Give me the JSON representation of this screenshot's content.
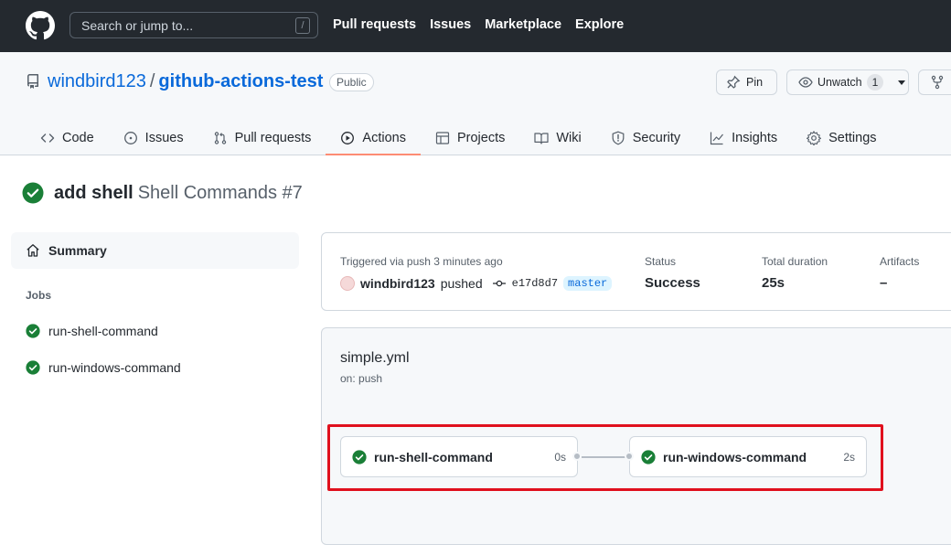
{
  "header": {
    "search_placeholder": "Search or jump to...",
    "search_shortcut": "/",
    "nav": [
      "Pull requests",
      "Issues",
      "Marketplace",
      "Explore"
    ]
  },
  "repo": {
    "owner": "windbird123",
    "separator": "/",
    "name": "github-actions-test",
    "visibility": "Public",
    "pin_label": "Pin",
    "watch_label": "Unwatch",
    "watch_count": "1"
  },
  "tabs": [
    {
      "label": "Code",
      "icon": "code-icon"
    },
    {
      "label": "Issues",
      "icon": "issue-icon"
    },
    {
      "label": "Pull requests",
      "icon": "pull-request-icon"
    },
    {
      "label": "Actions",
      "icon": "play-icon",
      "active": true
    },
    {
      "label": "Projects",
      "icon": "table-icon"
    },
    {
      "label": "Wiki",
      "icon": "book-icon"
    },
    {
      "label": "Security",
      "icon": "shield-icon"
    },
    {
      "label": "Insights",
      "icon": "graph-icon"
    },
    {
      "label": "Settings",
      "icon": "gear-icon"
    }
  ],
  "run": {
    "commit_message": "add shell",
    "workflow_and_number": "Shell Commands #7"
  },
  "sidebar": {
    "summary_label": "Summary",
    "jobs_label": "Jobs",
    "jobs": [
      "run-shell-command",
      "run-windows-command"
    ]
  },
  "summary_card": {
    "trigger": "Triggered via push 3 minutes ago",
    "actor": "windbird123",
    "action": "pushed",
    "sha": "e17d8d7",
    "branch": "master",
    "status_label": "Status",
    "status_value": "Success",
    "duration_label": "Total duration",
    "duration_value": "25s",
    "artifacts_label": "Artifacts",
    "artifacts_value": "–"
  },
  "workflow": {
    "file": "simple.yml",
    "on": "on: push",
    "jobs": [
      {
        "name": "run-shell-command",
        "duration": "0s"
      },
      {
        "name": "run-windows-command",
        "duration": "2s"
      }
    ]
  },
  "colors": {
    "success": "#1a7f37",
    "accent": "#0969da",
    "active_tab": "#fd8c73",
    "highlight": "#e0101d"
  }
}
